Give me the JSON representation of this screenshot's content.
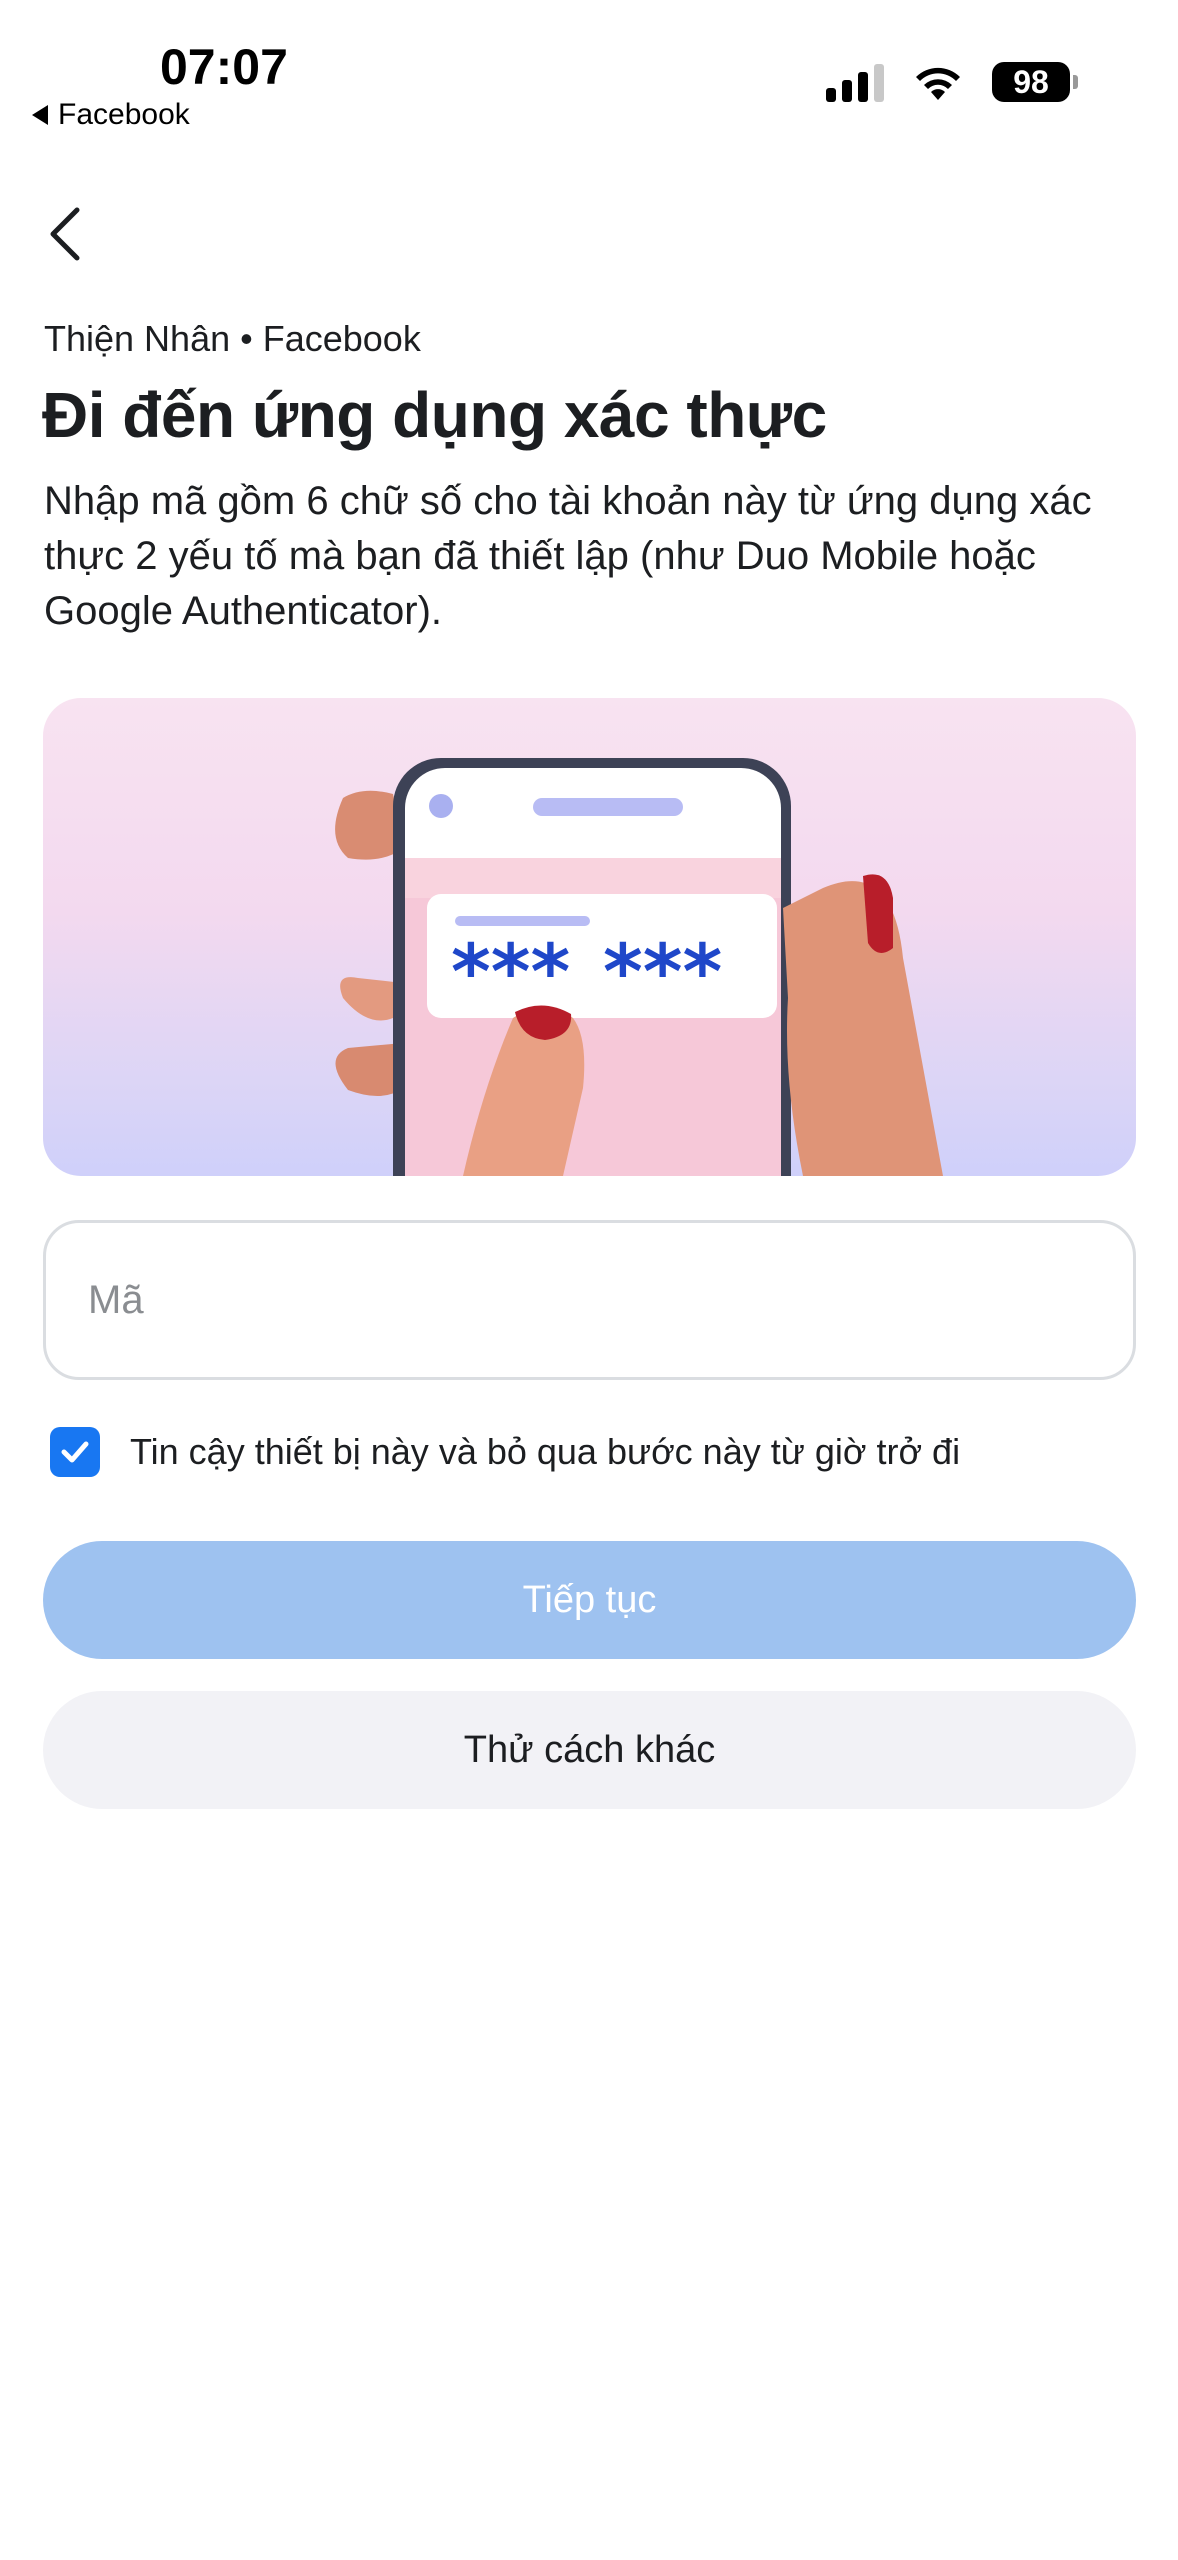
{
  "status_bar": {
    "time": "07:07",
    "back_app": "Facebook",
    "battery": "98"
  },
  "header": {
    "account_line": "Thiện Nhân • Facebook",
    "title": "Đi đến ứng dụng xác thực",
    "description": "Nhập mã gồm 6 chữ số cho tài khoản này từ ứng dụng xác thực 2 yếu tố mà bạn đã thiết lập (như Duo Mobile hoặc Google Authenticator)."
  },
  "illustration": {
    "code_left": "***",
    "code_right": "***"
  },
  "form": {
    "code_placeholder": "Mã",
    "code_value": "",
    "trust_checked": true,
    "trust_label": "Tin cậy thiết bị này và bỏ qua bước này từ giờ trở đi"
  },
  "buttons": {
    "continue_label": "Tiếp tục",
    "other_label": "Thử cách khác"
  },
  "colors": {
    "accent": "#1877f2",
    "continue_disabled": "#9ec2f0",
    "secondary_button": "#f2f2f6"
  }
}
